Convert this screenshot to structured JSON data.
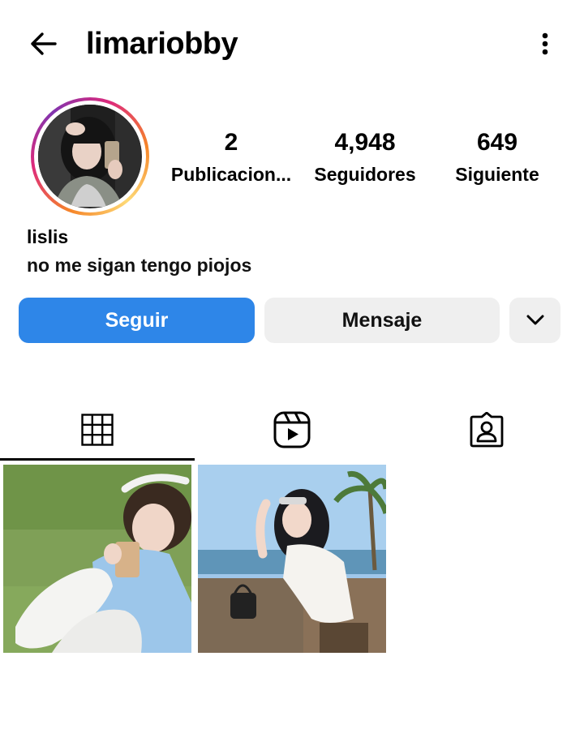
{
  "header": {
    "username": "limariobby",
    "back_icon": "arrow-left-icon",
    "more_icon": "kebab-menu-icon"
  },
  "profile": {
    "stats": [
      {
        "value": "2",
        "label": "Publicacion..."
      },
      {
        "value": "4,948",
        "label": "Seguidores"
      },
      {
        "value": "649",
        "label": "Siguiente"
      }
    ],
    "name": "lislis",
    "bio": "no me sigan tengo piojos"
  },
  "actions": {
    "follow_label": "Seguir",
    "message_label": "Mensaje",
    "more_icon": "chevron-down-icon"
  },
  "tabs": [
    {
      "icon": "grid-icon",
      "active": true
    },
    {
      "icon": "reels-icon",
      "active": false
    },
    {
      "icon": "tagged-icon",
      "active": false
    }
  ],
  "posts": [
    {
      "image": "girl-with-sunglasses-drinking-coffee-on-grass"
    },
    {
      "image": "girl-with-sunglasses-at-beach-cafe"
    }
  ],
  "colors": {
    "follow_button": "#2e86e8",
    "secondary_button": "#efefef"
  }
}
